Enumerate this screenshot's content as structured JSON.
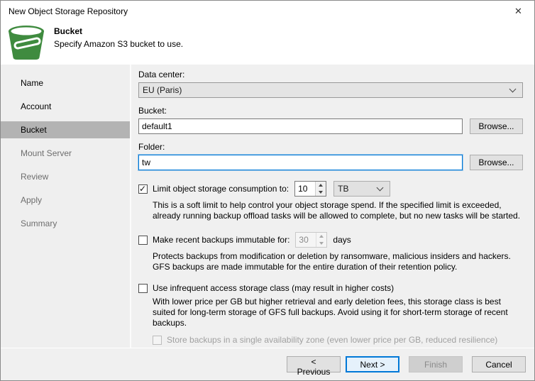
{
  "window": {
    "title": "New Object Storage Repository",
    "close_icon": "✕"
  },
  "header": {
    "title": "Bucket",
    "subtitle": "Specify Amazon S3 bucket to use.",
    "icon": "bucket-icon"
  },
  "sidebar": {
    "items": [
      {
        "label": "Name",
        "state": "done"
      },
      {
        "label": "Account",
        "state": "done"
      },
      {
        "label": "Bucket",
        "state": "active"
      },
      {
        "label": "Mount Server",
        "state": "muted"
      },
      {
        "label": "Review",
        "state": "muted"
      },
      {
        "label": "Apply",
        "state": "muted"
      },
      {
        "label": "Summary",
        "state": "muted"
      }
    ]
  },
  "form": {
    "data_center": {
      "label": "Data center:",
      "value": "EU (Paris)"
    },
    "bucket": {
      "label": "Bucket:",
      "value": "default1",
      "browse_label": "Browse..."
    },
    "folder": {
      "label": "Folder:",
      "value": "tw",
      "browse_label": "Browse..."
    },
    "limit": {
      "label": "Limit object storage consumption to:",
      "checkbox_state": "checked",
      "amount": "10",
      "unit": "TB",
      "hint": "This is a soft limit to help control your object storage spend. If the specified limit is exceeded, already running backup offload tasks will be allowed to complete, but no new tasks will be started."
    },
    "immutable": {
      "label": "Make recent backups immutable for:",
      "checkbox_state": "unchecked",
      "amount": "30",
      "unit": "days",
      "hint": "Protects backups from modification or deletion by ransomware, malicious insiders and hackers. GFS backups are made immutable for the entire duration of their retention policy."
    },
    "infrequent": {
      "label": "Use infrequent access storage class (may result in higher costs)",
      "checkbox_state": "unchecked",
      "hint": "With lower price per GB but higher retrieval and early deletion fees, this storage class is best suited for long-term storage of GFS full backups. Avoid using it for short-term storage of recent backups.",
      "single_zone": {
        "label": "Store backups in a single availability zone (even lower price per GB, reduced resilience)",
        "checkbox_state": "disabled"
      }
    }
  },
  "footer": {
    "previous_label": "< Previous",
    "next_label": "Next >",
    "finish_label": "Finish",
    "cancel_label": "Cancel"
  },
  "colors": {
    "accent_blue": "#0078d7",
    "bucket_green": "#3f8b3f",
    "sidebar_active_bg": "#b3b3b3"
  }
}
